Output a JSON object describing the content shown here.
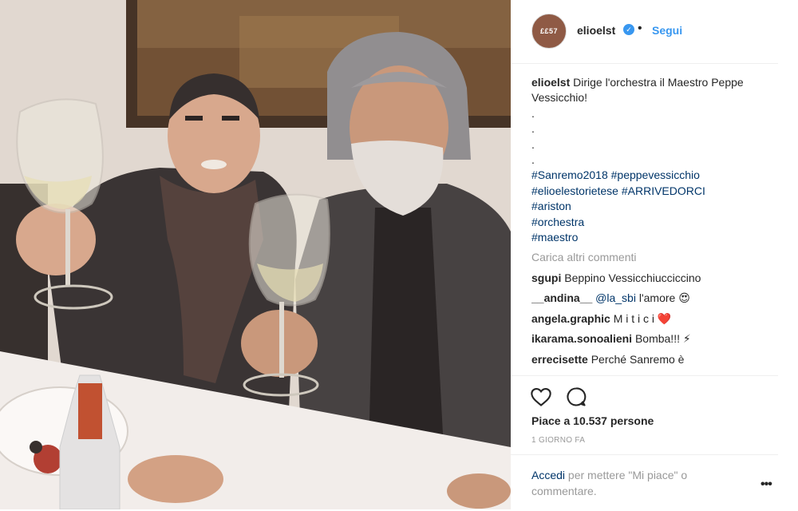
{
  "post": {
    "author": {
      "username": "elioelst",
      "avatar_text": "££57",
      "verified_glyph": "✓",
      "separator": "•",
      "follow_label": "Segui"
    },
    "caption": {
      "username": "elioelst",
      "text": "Dirige l'orchestra il Maestro Peppe Vessicchio!",
      "dots": [
        ".",
        ".",
        ".",
        "."
      ],
      "hashtags": [
        "#Sanremo2018 #peppevessicchio",
        "#elioelestorietese #ARRIVEDORCI",
        "#ariston",
        "#orchestra",
        "#maestro"
      ]
    },
    "load_more_label": "Carica altri commenti",
    "comments": [
      {
        "user": "sgupi",
        "text": "Beppino Vessicchiucciccino",
        "mention": ""
      },
      {
        "user": "__andina__",
        "text": "l'amore 😍",
        "mention": "@la_sbi"
      },
      {
        "user": "angela.graphic",
        "text": "M i t i c i ❤️",
        "mention": ""
      },
      {
        "user": "ikarama.sonoalieni",
        "text": "Bomba!!! ⚡",
        "mention": ""
      },
      {
        "user": "errecisette",
        "text": "Perché Sanremo è",
        "mention": ""
      }
    ],
    "likes_text": "Piace a 10.537 persone",
    "timestamp": "1 GIORNO FA",
    "login_prompt": {
      "link": "Accedi",
      "text": "per mettere \"Mi piace\" o commentare."
    },
    "more_options_label": "•••"
  },
  "icons": {
    "like": "heart-outline-icon",
    "comment": "speech-bubble-icon",
    "verified": "verified-badge-icon",
    "more": "more-options-icon"
  },
  "colors": {
    "accent": "#3897f0",
    "link": "#003569",
    "muted": "#999999",
    "text": "#262626"
  }
}
